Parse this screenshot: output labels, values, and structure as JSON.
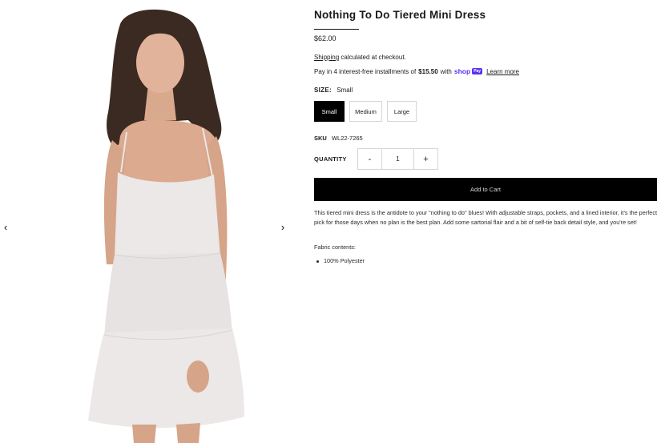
{
  "gallery": {
    "prev_icon": "chevron-left-icon",
    "next_icon": "chevron-right-icon",
    "prev_glyph": "‹",
    "next_glyph": "›"
  },
  "product": {
    "title": "Nothing To Do Tiered Mini Dress",
    "price": "$62.00",
    "shipping_link": "Shipping",
    "shipping_rest": "calculated at checkout.",
    "installments_prefix": "Pay in 4 interest-free installments of",
    "installments_amount": "$15.50",
    "installments_with": "with",
    "shop_logo": "shop",
    "shop_badge": "Pay",
    "learn_more": "Learn more"
  },
  "size": {
    "label": "SIZE:",
    "selected": "Small",
    "options": [
      "Small",
      "Medium",
      "Large"
    ]
  },
  "sku": {
    "label": "SKU",
    "value": "WL22-7265"
  },
  "quantity": {
    "label": "QUANTITY",
    "minus": "-",
    "value": "1",
    "plus": "+"
  },
  "cart": {
    "add_label": "Add to Cart"
  },
  "description": {
    "body": "This tiered mini dress is the antidote to your \"nothing to do\" blues! With adjustable straps, pockets, and a lined interior, it's the perfect pick for those days when no plan is the best plan. Add some sartorial flair and a bit of self-tie back detail style, and you're set!",
    "fabric_label": "Fabric contents:",
    "fabric_items": [
      "100% Polyester"
    ]
  },
  "colors": {
    "shop_pay": "#5a31f4",
    "button_bg": "#000000",
    "dress": "#ebe8e7"
  }
}
